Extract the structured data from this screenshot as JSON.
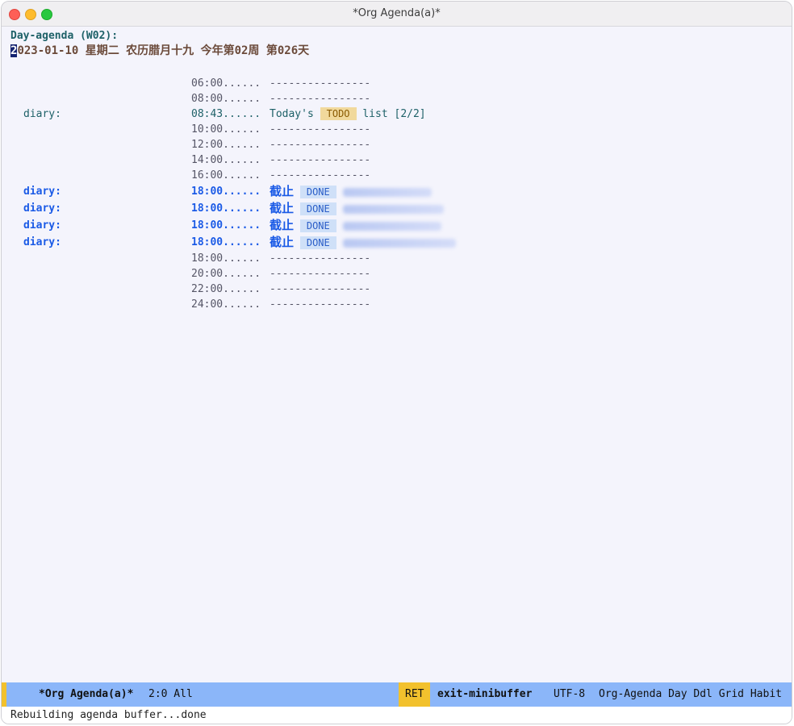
{
  "window": {
    "title": "*Org Agenda(a)*"
  },
  "agenda": {
    "header": "Day-agenda (W02):",
    "date_first_char": "2",
    "date_rest": "023-01-10 星期二 农历腊月十九 今年第02周 第026天",
    "rows": [
      {
        "cat": "",
        "time": "06:00......",
        "kind": "grid",
        "text": "----------------"
      },
      {
        "cat": "",
        "time": "08:00......",
        "kind": "grid",
        "text": "----------------"
      },
      {
        "cat": "diary:",
        "time": "08:43......",
        "kind": "diary",
        "pre": "Today's",
        "todo": "TODO",
        "post": "list [2/2]"
      },
      {
        "cat": "",
        "time": "10:00......",
        "kind": "grid",
        "text": "----------------"
      },
      {
        "cat": "",
        "time": "12:00......",
        "kind": "grid",
        "text": "----------------"
      },
      {
        "cat": "",
        "time": "14:00......",
        "kind": "grid",
        "text": "----------------"
      },
      {
        "cat": "",
        "time": "16:00......",
        "kind": "grid",
        "text": "----------------"
      },
      {
        "cat": "diary:",
        "time": "18:00......",
        "kind": "deadline",
        "label": "截止",
        "state": "DONE"
      },
      {
        "cat": "diary:",
        "time": "18:00......",
        "kind": "deadline",
        "label": "截止",
        "state": "DONE"
      },
      {
        "cat": "diary:",
        "time": "18:00......",
        "kind": "deadline",
        "label": "截止",
        "state": "DONE"
      },
      {
        "cat": "diary:",
        "time": "18:00......",
        "kind": "deadline",
        "label": "截止",
        "state": "DONE"
      },
      {
        "cat": "",
        "time": "18:00......",
        "kind": "grid",
        "text": "----------------"
      },
      {
        "cat": "",
        "time": "20:00......",
        "kind": "grid",
        "text": "----------------"
      },
      {
        "cat": "",
        "time": "22:00......",
        "kind": "grid",
        "text": "----------------"
      },
      {
        "cat": "",
        "time": "24:00......",
        "kind": "grid",
        "text": "----------------"
      }
    ]
  },
  "modeline": {
    "lock_icon": "lock-icon",
    "buffer_name": "*Org Agenda(a)*",
    "position": "2:0 All",
    "key": "RET",
    "command": "exit-minibuffer",
    "encoding": "UTF-8",
    "modes": "Org-Agenda Day Ddl Grid Habit"
  },
  "echo_area": {
    "message": "Rebuilding agenda buffer...done"
  }
}
